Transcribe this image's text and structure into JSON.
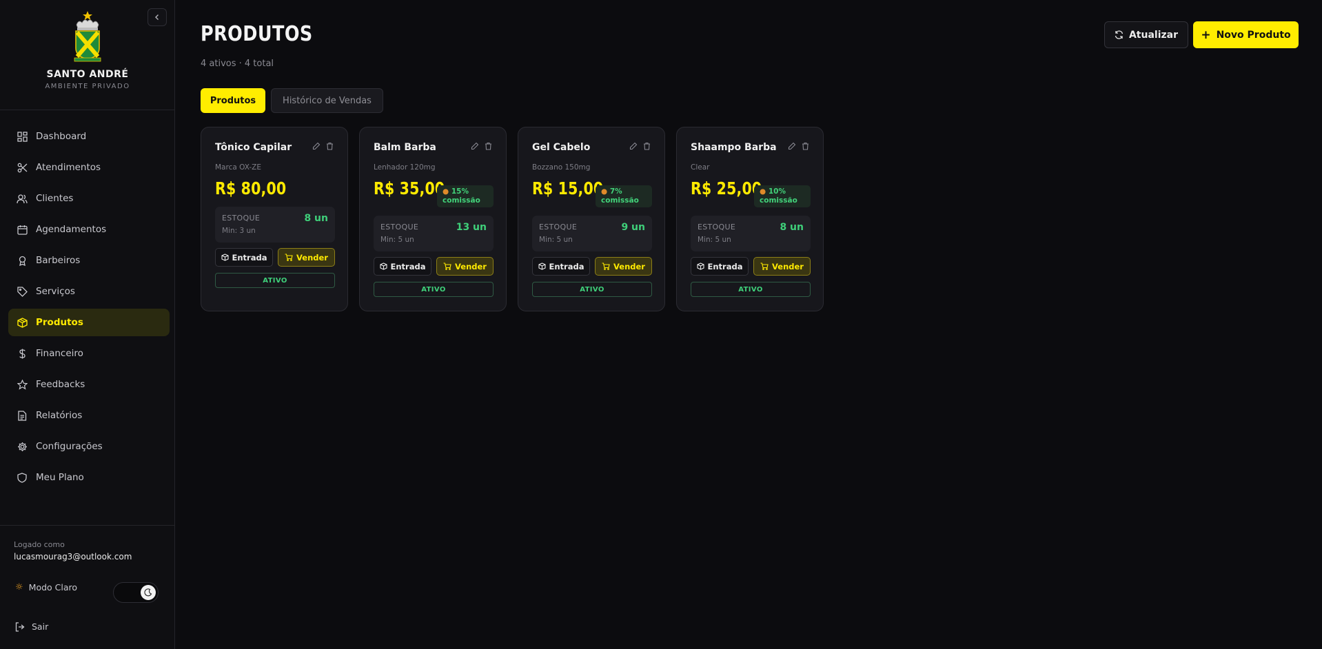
{
  "sidebar": {
    "brand_name": "SANTO ANDRÉ",
    "brand_sub": "AMBIENTE PRIVADO",
    "items": [
      {
        "label": "Dashboard",
        "icon": "grid-icon"
      },
      {
        "label": "Atendimentos",
        "icon": "scissors-icon"
      },
      {
        "label": "Clientes",
        "icon": "users-icon"
      },
      {
        "label": "Agendamentos",
        "icon": "calendar-icon"
      },
      {
        "label": "Barbeiros",
        "icon": "award-icon"
      },
      {
        "label": "Serviços",
        "icon": "tag-icon"
      },
      {
        "label": "Produtos",
        "icon": "package-icon"
      },
      {
        "label": "Financeiro",
        "icon": "dollar-icon"
      },
      {
        "label": "Feedbacks",
        "icon": "star-icon"
      },
      {
        "label": "Relatórios",
        "icon": "file-icon"
      },
      {
        "label": "Configurações",
        "icon": "gear-icon"
      },
      {
        "label": "Meu Plano",
        "icon": "shield-icon"
      }
    ],
    "active_item": "Produtos",
    "logged_label": "Logado como",
    "logged_email": "lucasmourag3@outlook.com",
    "theme_label": "Modo Claro",
    "logout_label": "Sair"
  },
  "header": {
    "title": "PRODUTOS",
    "subtitle": "4 ativos · 4 total",
    "refresh_label": "Atualizar",
    "new_label": "Novo Produto"
  },
  "tabs": {
    "products": "Produtos",
    "history": "Histórico de Vendas"
  },
  "products": [
    {
      "name": "Tônico Capilar",
      "brand": "Marca OX-ZE",
      "price": "R$ 80,00",
      "commission": "",
      "stock_label": "ESTOQUE",
      "stock": "8 un",
      "min": "Min: 3 un",
      "in_label": "Entrada",
      "sell_label": "Vender",
      "status": "ATIVO"
    },
    {
      "name": "Balm Barba",
      "brand": "Lenhador 120mg",
      "price": "R$ 35,00",
      "commission": "15%",
      "commission_word": "comissão",
      "stock_label": "ESTOQUE",
      "stock": "13 un",
      "min": "Min: 5 un",
      "in_label": "Entrada",
      "sell_label": "Vender",
      "status": "ATIVO"
    },
    {
      "name": "Gel Cabelo",
      "brand": "Bozzano 150mg",
      "price": "R$ 15,00",
      "commission": "7%",
      "commission_word": "comissão",
      "stock_label": "ESTOQUE",
      "stock": "9 un",
      "min": "Min: 5 un",
      "in_label": "Entrada",
      "sell_label": "Vender",
      "status": "ATIVO"
    },
    {
      "name": "Shaampo Barba",
      "brand": "Clear",
      "price": "R$ 25,00",
      "commission": "10%",
      "commission_word": "comissão",
      "stock_label": "ESTOQUE",
      "stock": "8 un",
      "min": "Min: 5 un",
      "in_label": "Entrada",
      "sell_label": "Vender",
      "status": "ATIVO"
    }
  ],
  "colors": {
    "accent": "#ffed00",
    "success": "#3fd07a",
    "background": "#0c0c0f"
  }
}
